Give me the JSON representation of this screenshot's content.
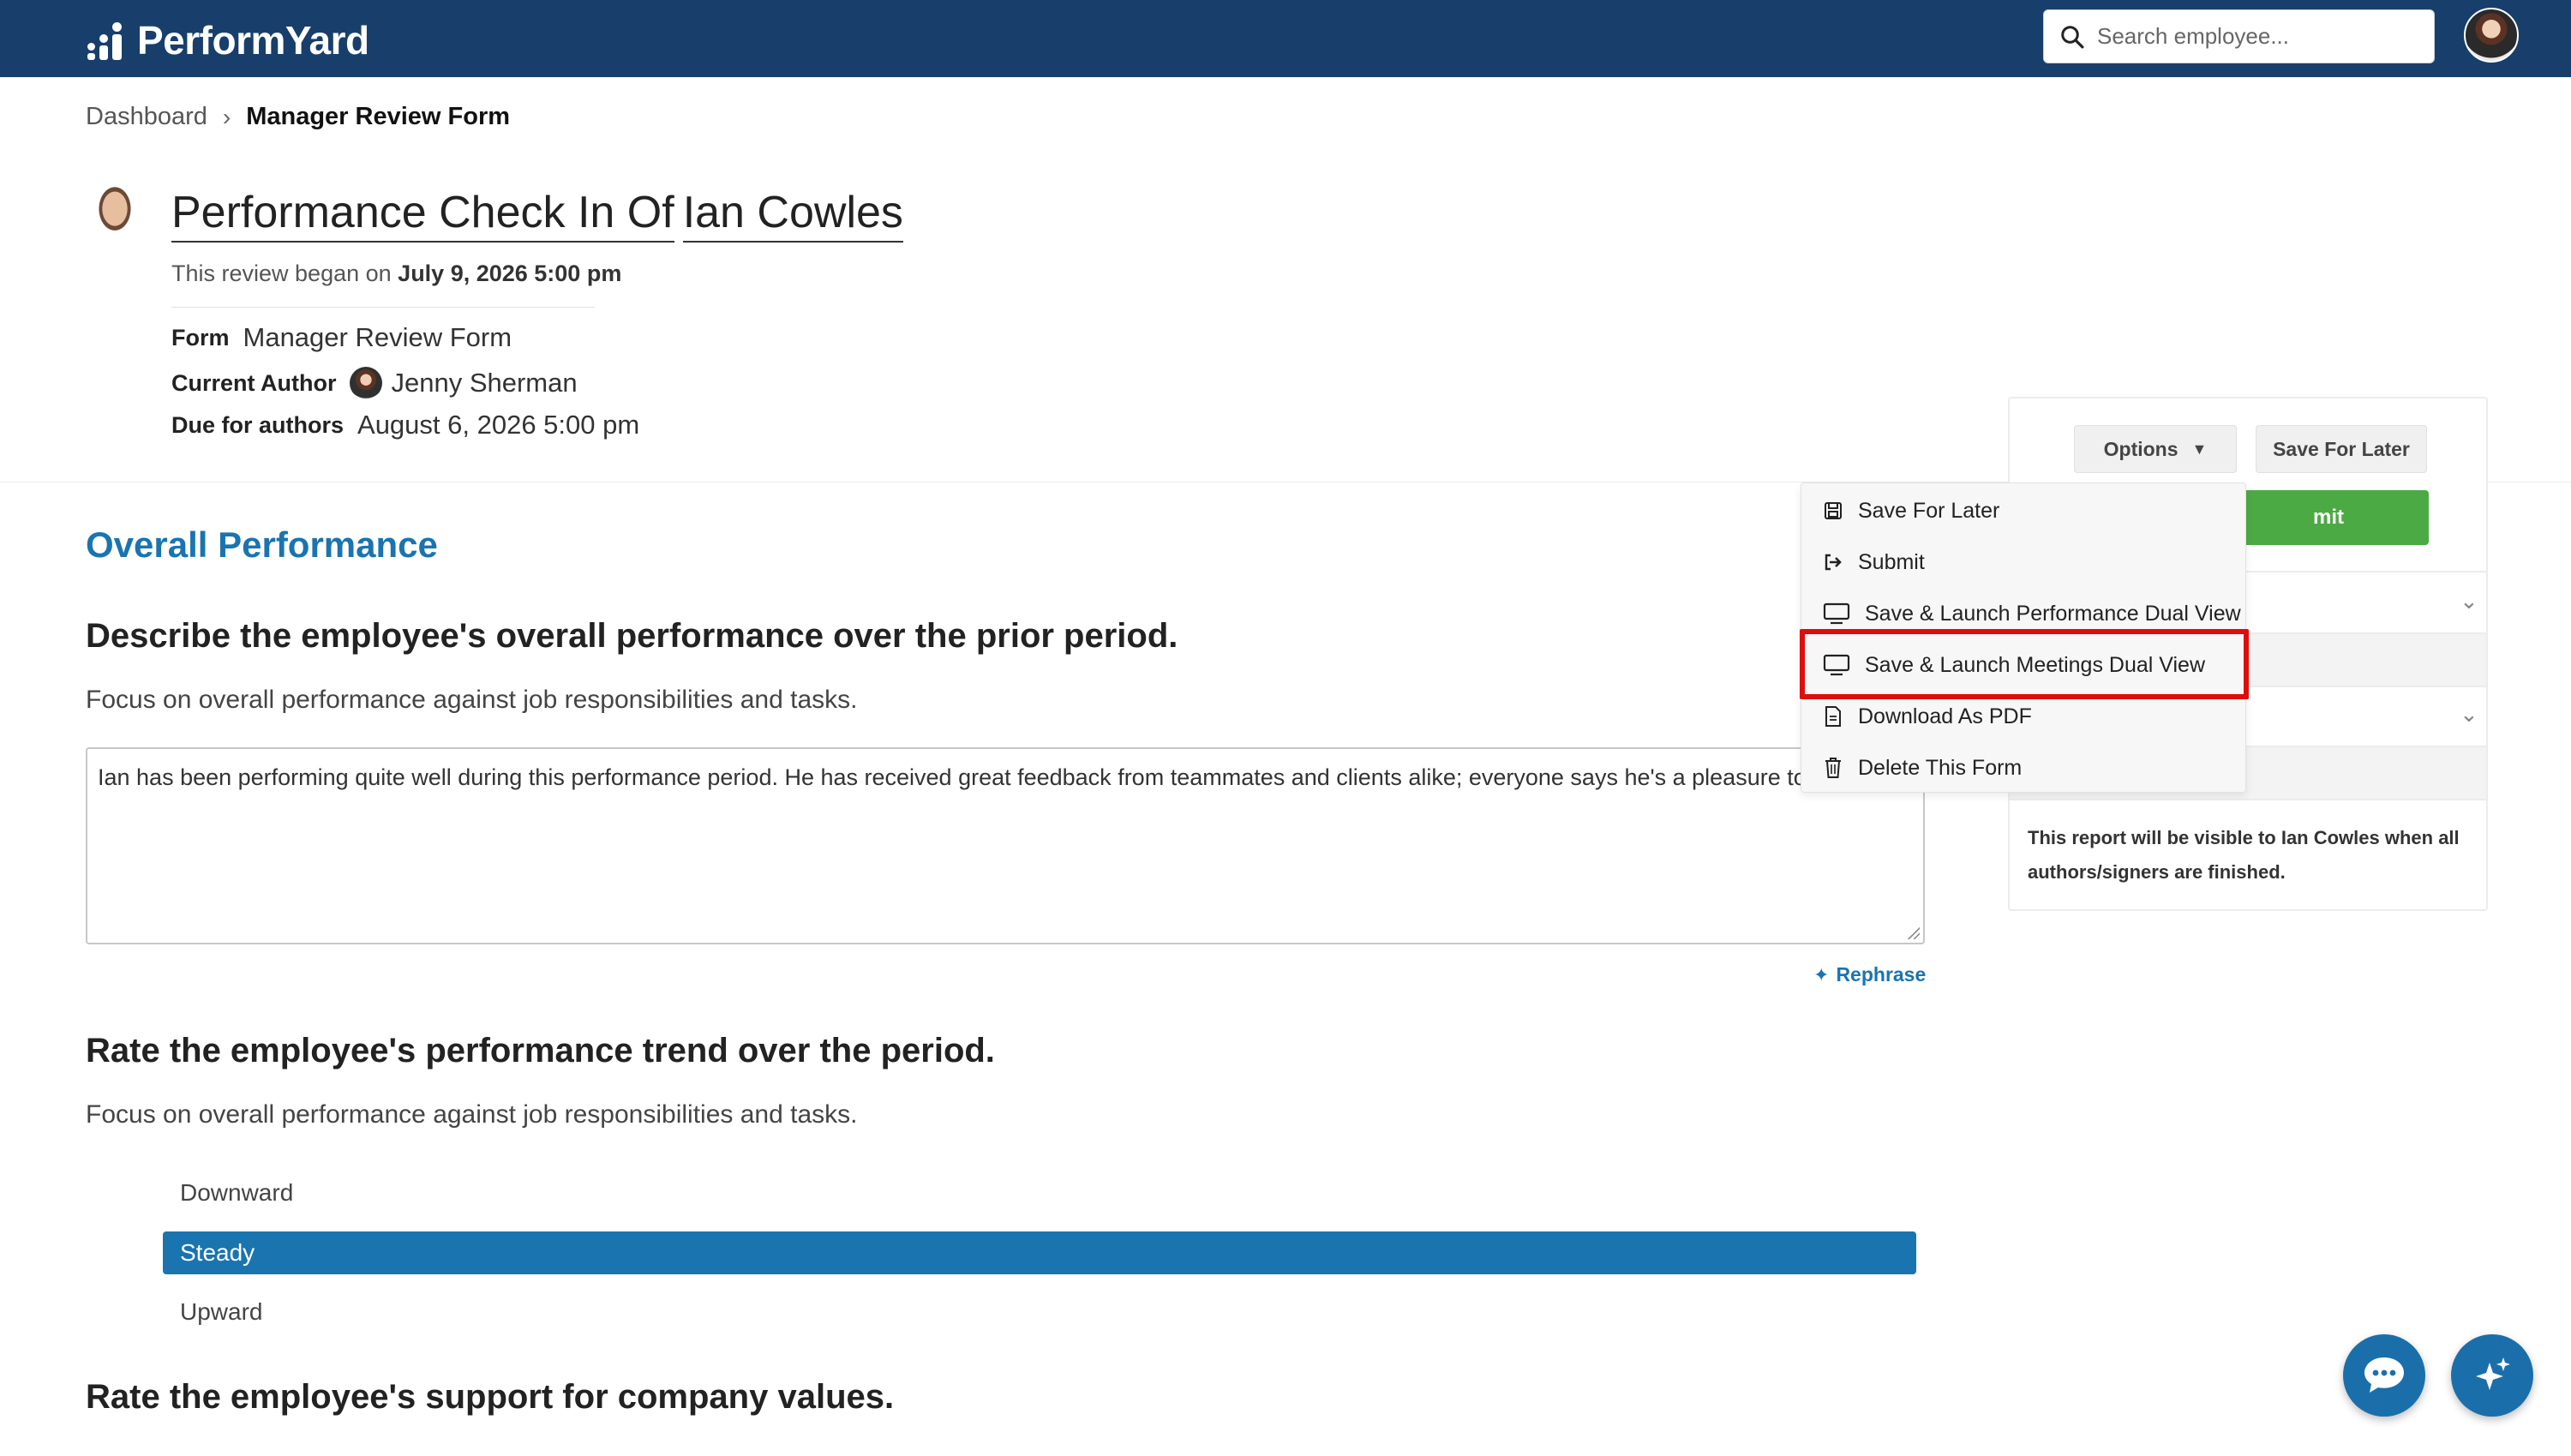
{
  "app": {
    "brand": "PerformYard",
    "search_placeholder": "Search employee..."
  },
  "breadcrumb": {
    "root": "Dashboard",
    "current": "Manager Review Form"
  },
  "review": {
    "title_part1": "Performance Check In Of",
    "title_part2": "Ian Cowles",
    "began_prefix": "This review began on",
    "began_date": "July 9, 2026 5:00 pm",
    "form_label": "Form",
    "form_value": "Manager Review Form",
    "author_label": "Current Author",
    "author_value": "Jenny Sherman",
    "due_label": "Due for authors",
    "due_value": "August 6, 2026 5:00 pm"
  },
  "form": {
    "section_title": "Overall Performance",
    "q1_title": "Describe the employee's overall performance over the prior period.",
    "q1_help": "Focus on overall performance against job responsibilities and tasks.",
    "q1_answer": "Ian has been performing quite well during this performance period. He has received great feedback from teammates and clients alike; everyone says he's a pleasure to work w",
    "rephrase_label": "Rephrase",
    "q2_title": "Rate the employee's performance trend over the period.",
    "q2_help": "Focus on overall performance against job responsibilities and tasks.",
    "q2_options": [
      "Downward",
      "Steady",
      "Upward"
    ],
    "q2_selected": "Steady",
    "q3_title": "Rate the employee's support for company values."
  },
  "panel": {
    "options_label": "Options",
    "save_later_label": "Save For Later",
    "submit_label_visible": "mit",
    "visibility_note": "This report will be visible to Ian Cowles when all authors/signers are finished."
  },
  "menu": {
    "items": [
      {
        "label": "Save For Later",
        "icon": "save-icon"
      },
      {
        "label": "Submit",
        "icon": "submit-icon"
      },
      {
        "label": "Save & Launch Performance Dual View",
        "icon": "monitor-icon"
      },
      {
        "label": "Save & Launch Meetings Dual View",
        "icon": "monitor-icon"
      },
      {
        "label": "Download As PDF",
        "icon": "document-icon"
      },
      {
        "label": "Delete This Form",
        "icon": "trash-icon"
      }
    ],
    "highlighted": "Save & Launch Meetings Dual View",
    "highlight_color": "#e00d0d"
  },
  "colors": {
    "navbar": "#183f6b",
    "accent": "#1a74b0",
    "submit": "#4caa44"
  }
}
